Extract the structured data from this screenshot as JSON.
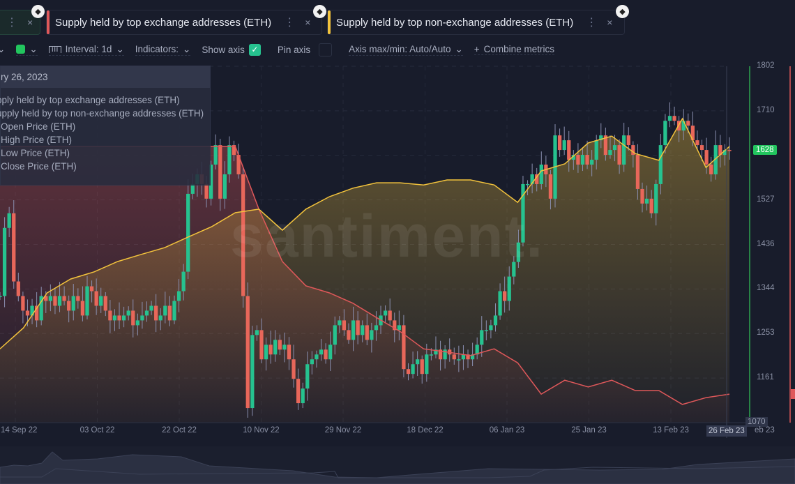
{
  "tabs": [
    {
      "label": "",
      "color": "#1d2a2d"
    },
    {
      "label": "Supply held by top exchange addresses (ETH)",
      "color": "#e0585a"
    },
    {
      "label": "Supply held by top non-exchange addresses (ETH)",
      "color": "#f3c33c"
    }
  ],
  "tab_icons": {
    "menu": "⋮",
    "close": "×",
    "eth": "◆"
  },
  "toolbar": {
    "interval": "Interval: 1d",
    "indicators": "Indicators:",
    "show_axis": "Show axis",
    "show_axis_checked": true,
    "pin_axis": "Pin axis",
    "pin_axis_checked": false,
    "axis_maxmin": "Axis max/min: Auto/Auto",
    "combine": "Combine metrics",
    "color_swatch": "#22c55e"
  },
  "tooltip": {
    "date": "ry 26, 2023",
    "rows": [
      "pply held by top exchange addresses (ETH)",
      "upply held by top non-exchange addresses (ETH)",
      "Open Price (ETH)",
      "High Price (ETH)",
      "Low Price (ETH)",
      "Close Price (ETH)"
    ]
  },
  "watermark": "santiment.",
  "chart_data": {
    "type": "candlestick",
    "y_ticks": [
      "1802",
      "1710",
      "1619",
      "1527",
      "1436",
      "1344",
      "1253",
      "1161",
      "1070"
    ],
    "ylim": [
      1070,
      1802
    ],
    "x_ticks": [
      "14 Sep 22",
      "03 Oct 22",
      "22 Oct 22",
      "10 Nov 22",
      "29 Nov 22",
      "18 Dec 22",
      "06 Jan 23",
      "25 Jan 23",
      "13 Feb 23",
      "26 Feb 23"
    ],
    "x_partial_tick": "eb 23",
    "last_price": "1628",
    "colors": {
      "up": "#26c28f",
      "down": "#e8675a",
      "exchange": "#e0585a",
      "non_exchange": "#f3c33c",
      "axis": "#2ea44f"
    },
    "close": [
      1330,
      1470,
      1500,
      1360,
      1330,
      1300,
      1290,
      1310,
      1280,
      1330,
      1320,
      1330,
      1310,
      1330,
      1320,
      1300,
      1330,
      1320,
      1290,
      1350,
      1340,
      1310,
      1330,
      1300,
      1280,
      1290,
      1280,
      1290,
      1300,
      1270,
      1280,
      1290,
      1300,
      1310,
      1280,
      1290,
      1310,
      1280,
      1320,
      1340,
      1380,
      1540,
      1560,
      1580,
      1560,
      1530,
      1600,
      1640,
      1530,
      1580,
      1640,
      1620,
      1580,
      1330,
      1100,
      1250,
      1260,
      1200,
      1230,
      1210,
      1240,
      1220,
      1230,
      1200,
      1160,
      1110,
      1140,
      1190,
      1200,
      1210,
      1220,
      1200,
      1230,
      1270,
      1280,
      1260,
      1240,
      1280,
      1250,
      1270,
      1240,
      1260,
      1270,
      1290,
      1300,
      1280,
      1260,
      1270,
      1180,
      1170,
      1190,
      1200,
      1170,
      1210,
      1210,
      1220,
      1200,
      1220,
      1210,
      1200,
      1200,
      1210,
      1200,
      1210,
      1230,
      1260,
      1260,
      1270,
      1290,
      1340,
      1320,
      1370,
      1400,
      1440,
      1560,
      1560,
      1580,
      1560,
      1600,
      1580,
      1530,
      1660,
      1630,
      1650,
      1610,
      1620,
      1600,
      1620,
      1600,
      1610,
      1650,
      1660,
      1620,
      1630,
      1640,
      1600,
      1660,
      1640,
      1620,
      1550,
      1520,
      1530,
      1500,
      1560,
      1640,
      1690,
      1700,
      1690,
      1670,
      1690,
      1680,
      1650,
      1640,
      1630,
      1600,
      1580,
      1640,
      1620,
      1630,
      1628
    ],
    "series": [
      {
        "name": "Supply held by top non-exchange addresses (ETH)",
        "relative_level": [
          20.7,
          26.6,
          36.4,
          40.3,
          42.3,
          45.2,
          47.2,
          49.1,
          52.1,
          55,
          58.9,
          59.9,
          54,
          59.9,
          63.4,
          65.8,
          67.3,
          67.3,
          66.7,
          68.1,
          68.1,
          66.7,
          61.8,
          70.6,
          72.6,
          78.5,
          80.4,
          75.5,
          73.6,
          85.3,
          71.6,
          77.5
        ]
      },
      {
        "name": "Supply held by top exchange addresses (ETH)",
        "relative_level": [
          77.5,
          77.5,
          77.5,
          77.5,
          77.5,
          77.5,
          77.5,
          77.5,
          77.5,
          77.5,
          77.5,
          59.9,
          45.2,
          38.4,
          36.4,
          33.5,
          29.5,
          25.6,
          20.7,
          19.8,
          18.8,
          20.7,
          16.8,
          8,
          11.9,
          10,
          11.9,
          9,
          9,
          5.1,
          7,
          8
        ]
      }
    ]
  }
}
